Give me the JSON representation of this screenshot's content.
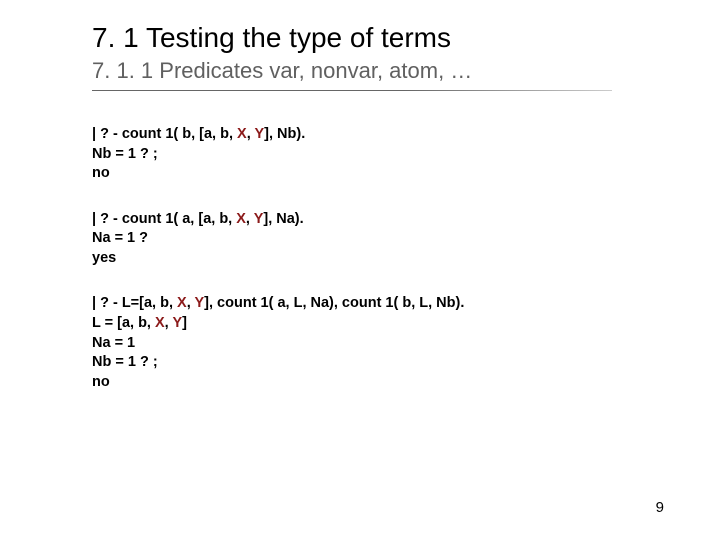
{
  "title": "7. 1 Testing the type of terms",
  "subtitle": "7. 1. 1 Predicates var, nonvar, atom, …",
  "blocks": {
    "b1": {
      "q_pre": "| ? - count 1( b, [a, b, ",
      "q_mid1": "X",
      "q_sep": ", ",
      "q_mid2": "Y",
      "q_post": "], Nb).",
      "line2": "Nb = 1 ? ;",
      "line3": "no"
    },
    "b2": {
      "q_pre": "| ? - count 1( a, [a, b, ",
      "q_mid1": "X",
      "q_sep": ", ",
      "q_mid2": "Y",
      "q_post": "], Na).",
      "line2": "Na = 1 ?",
      "line3": "yes"
    },
    "b3": {
      "q_pre": "| ? - L=[a, b, ",
      "q_mid1": "X",
      "q_sep": ", ",
      "q_mid2": "Y",
      "q_post": "], count 1( a, L, Na), count 1( b, L, Nb).",
      "l2_pre": "L = [a, b, ",
      "l2_mid1": "X",
      "l2_sep": ", ",
      "l2_mid2": "Y",
      "l2_post": "]",
      "line3": "Na = 1",
      "line4": "Nb = 1 ? ;",
      "line5": "no"
    }
  },
  "page_number": "9"
}
